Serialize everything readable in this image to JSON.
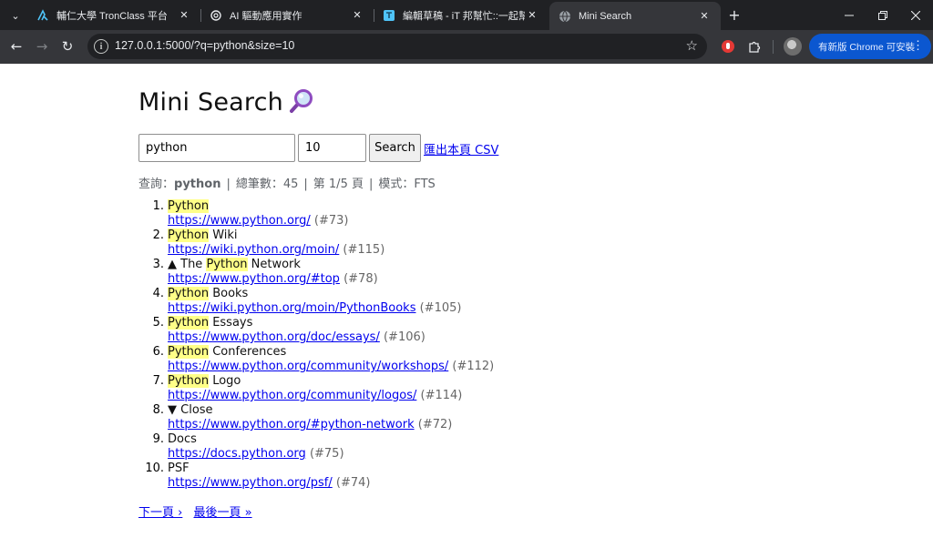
{
  "browser": {
    "tabs": [
      {
        "title": "輔仁大學 TronClass 平台",
        "icon": "tronclass-icon",
        "active": false
      },
      {
        "title": "AI 驅動應用實作",
        "icon": "openai-icon",
        "active": false
      },
      {
        "title": "編輯草稿 - iT 邦幫忙::一起幫忙解決難題",
        "icon": "ithome-icon",
        "active": false
      },
      {
        "title": "Mini Search",
        "icon": "globe-icon",
        "active": true
      }
    ],
    "url": "127.0.0.1:5000/?q=python&size=10",
    "update_label": "有新版 Chrome 可安裝"
  },
  "page": {
    "title": "Mini Search",
    "title_icon": "magnifier-icon",
    "search": {
      "query_value": "python",
      "size_value": "10",
      "button_label": "Search",
      "export_link": "匯出本頁 CSV"
    },
    "meta": {
      "query_label": "查詢：",
      "query": "python",
      "total_label": "總筆數：45",
      "page_label": "第 1/5 頁",
      "mode_label": "模式：FTS"
    },
    "results": [
      {
        "n": "1.",
        "pre": "",
        "hl": "Python",
        "post": "",
        "url": "https://www.python.org/",
        "id": "(#73)"
      },
      {
        "n": "2.",
        "pre": "",
        "hl": "Python",
        "post": " Wiki",
        "url": "https://wiki.python.org/moin/",
        "id": "(#115)"
      },
      {
        "n": "3.",
        "pre": "▲ The ",
        "hl": "Python",
        "post": " Network",
        "url": "https://www.python.org/#top",
        "id": "(#78)"
      },
      {
        "n": "4.",
        "pre": "",
        "hl": "Python",
        "post": " Books",
        "url": "https://wiki.python.org/moin/PythonBooks",
        "id": "(#105)"
      },
      {
        "n": "5.",
        "pre": "",
        "hl": "Python",
        "post": " Essays",
        "url": "https://www.python.org/doc/essays/",
        "id": "(#106)"
      },
      {
        "n": "6.",
        "pre": "",
        "hl": "Python",
        "post": " Conferences",
        "url": "https://www.python.org/community/workshops/",
        "id": "(#112)"
      },
      {
        "n": "7.",
        "pre": "",
        "hl": "Python",
        "post": " Logo",
        "url": "https://www.python.org/community/logos/",
        "id": "(#114)"
      },
      {
        "n": "8.",
        "pre": "▼ Close",
        "hl": "",
        "post": "",
        "url": "https://www.python.org/#python-network",
        "id": "(#72)"
      },
      {
        "n": "9.",
        "pre": "Docs",
        "hl": "",
        "post": "",
        "url": "https://docs.python.org",
        "id": "(#75)"
      },
      {
        "n": "10.",
        "pre": "PSF",
        "hl": "",
        "post": "",
        "url": "https://www.python.org/psf/",
        "id": "(#74)"
      }
    ],
    "pager": {
      "next": "下一頁 ›",
      "last": "最後一頁 »"
    }
  }
}
